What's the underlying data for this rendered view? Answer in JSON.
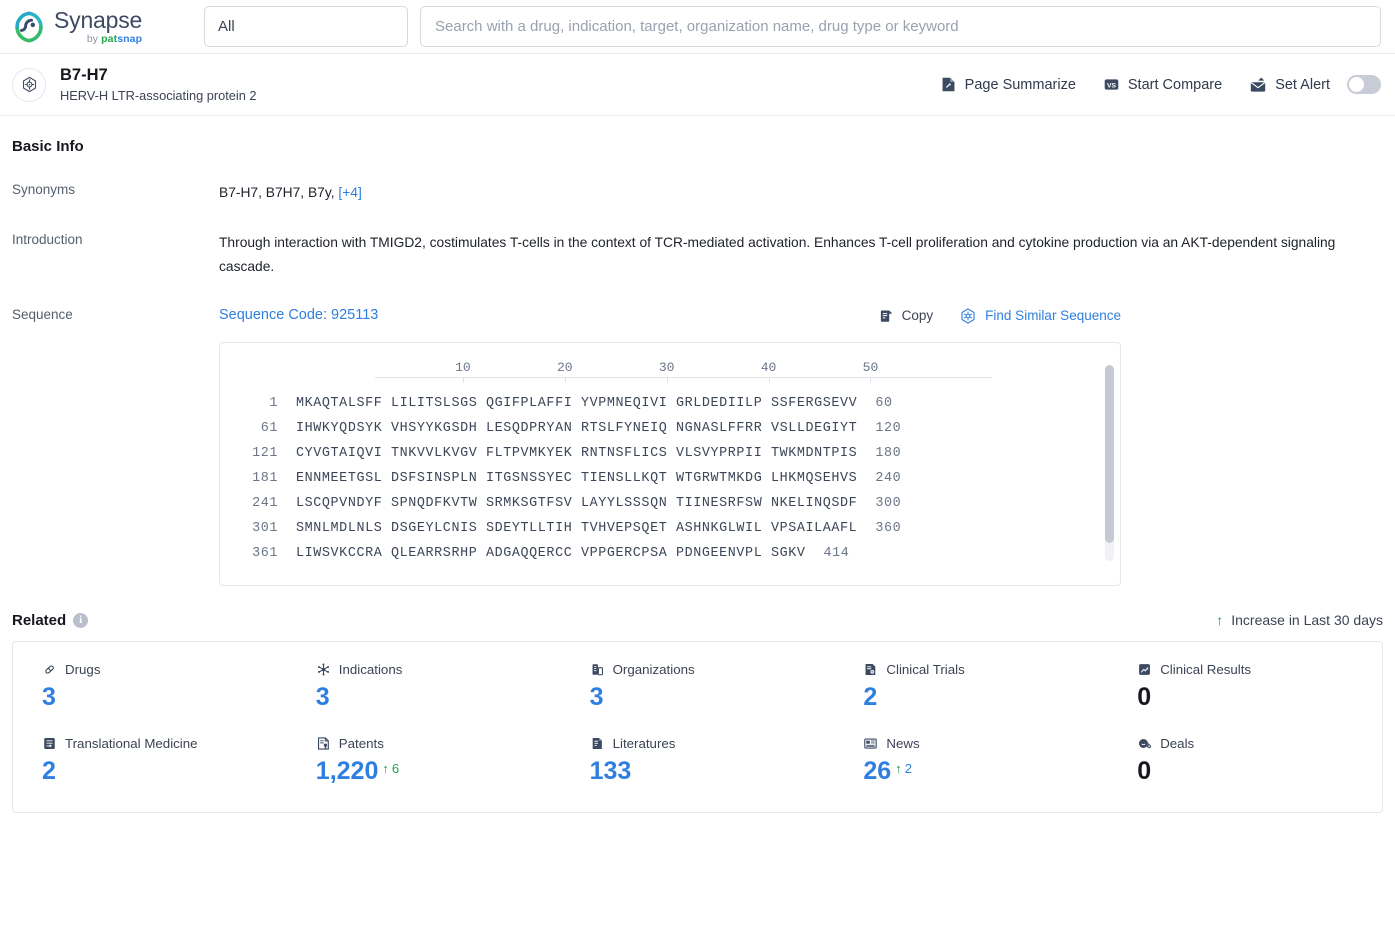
{
  "topbar": {
    "logo": {
      "name": "Synapse",
      "by": "by ",
      "pat": "pat",
      "snap": "snap"
    },
    "scope": {
      "value": "All",
      "icon": "chevron-down-icon"
    },
    "search": {
      "value": "",
      "placeholder": "Search with a drug, indication, target, organization name, drug type or keyword"
    }
  },
  "entity": {
    "icon": "target-icon",
    "title": "B7-H7",
    "subtitle": "HERV-H LTR-associating protein 2",
    "actions": [
      {
        "label": "Page Summarize",
        "icon": "summarize-icon"
      },
      {
        "label": "Start Compare",
        "icon": "vs-icon"
      },
      {
        "label": "Set Alert",
        "icon": "alert-mail-icon"
      }
    ],
    "alert_toggle": "off"
  },
  "basic_info": {
    "heading": "Basic Info",
    "synonyms_label": "Synonyms",
    "synonyms_value": "B7-H7,  B7H7,  B7y,",
    "synonyms_more": "[+4]",
    "introduction_label": "Introduction",
    "introduction_value": "Through interaction with TMIGD2, costimulates T-cells in the context of TCR-mediated activation. Enhances T-cell proliferation and cytokine production via an AKT-dependent signaling cascade.",
    "sequence_label": "Sequence"
  },
  "sequence": {
    "code_label": "Sequence Code: 925113",
    "copy_label": "Copy",
    "copy_icon": "copy-icon",
    "find_similar_label": "Find Similar Sequence",
    "find_similar_icon": "find-similar-icon",
    "ruler_ticks": [
      10,
      20,
      30,
      40,
      50
    ],
    "lines": [
      {
        "start": "1",
        "body": "MKAQTALSFF LILITSLSGS QGIFPLAFFI YVPMNEQIVI GRLDEDIILP SSFERGSEVV",
        "end": "60"
      },
      {
        "start": "61",
        "body": "IHWKYQDSYK VHSYYKGSDH LESQDPRYAN RTSLFYNEIQ NGNASLFFRR VSLLDEGIYT",
        "end": "120"
      },
      {
        "start": "121",
        "body": "CYVGTAIQVI TNKVVLKVGV FLTPVMKYEK RNTNSFLICS VLSVYPRPII TWKMDNTPIS",
        "end": "180"
      },
      {
        "start": "181",
        "body": "ENNMEETGSL DSFSINSPLN ITGSNSSYEC TIENSLLKQT WTGRWTMKDG LHKMQSEHVS",
        "end": "240"
      },
      {
        "start": "241",
        "body": "LSCQPVNDYF SPNQDFKVTW SRMKSGTFSV LAYYLSSSQN TIINESRFSW NKELINQSDF",
        "end": "300"
      },
      {
        "start": "301",
        "body": "SMNLMDLNLS DSGEYLCNIS SDEYTLLTIH TVHVEPSQET ASHNKGLWIL VPSAILAAFL",
        "end": "360"
      },
      {
        "start": "361",
        "body": "LIWSVKCCRA QLEARRSRHP ADGAQQERCC VPPGERCPSA PDNGEENVPL SGKV",
        "end": "414"
      }
    ]
  },
  "related": {
    "title": "Related",
    "info_icon": "info-icon",
    "legend": "Increase in Last 30 days",
    "legend_icon": "arrow-up-icon",
    "stats": [
      {
        "label": "Drugs",
        "icon": "drug-capsule-icon",
        "value": "3",
        "zero": false,
        "delta": null,
        "delta_color": null
      },
      {
        "label": "Indications",
        "icon": "indications-icon",
        "value": "3",
        "zero": false,
        "delta": null,
        "delta_color": null
      },
      {
        "label": "Organizations",
        "icon": "organization-icon",
        "value": "3",
        "zero": false,
        "delta": null,
        "delta_color": null
      },
      {
        "label": "Clinical Trials",
        "icon": "clinical-trials-icon",
        "value": "2",
        "zero": false,
        "delta": null,
        "delta_color": null
      },
      {
        "label": "Clinical Results",
        "icon": "clinical-results-icon",
        "value": "0",
        "zero": true,
        "delta": null,
        "delta_color": null
      },
      {
        "label": "Translational Medicine",
        "icon": "translational-icon",
        "value": "2",
        "zero": false,
        "delta": null,
        "delta_color": null
      },
      {
        "label": "Patents",
        "icon": "patents-icon",
        "value": "1,220",
        "zero": false,
        "delta": "6",
        "delta_color": "green"
      },
      {
        "label": "Literatures",
        "icon": "literature-icon",
        "value": "133",
        "zero": false,
        "delta": null,
        "delta_color": null
      },
      {
        "label": "News",
        "icon": "news-icon",
        "value": "26",
        "zero": false,
        "delta": "2",
        "delta_color": "blue"
      },
      {
        "label": "Deals",
        "icon": "deals-icon",
        "value": "0",
        "zero": true,
        "delta": null,
        "delta_color": null
      }
    ]
  },
  "colors": {
    "accent": "#2f7fe0",
    "green": "#22a04b",
    "text": "#1d2129",
    "muted": "#555f6e",
    "border": "#e3e7ee"
  }
}
